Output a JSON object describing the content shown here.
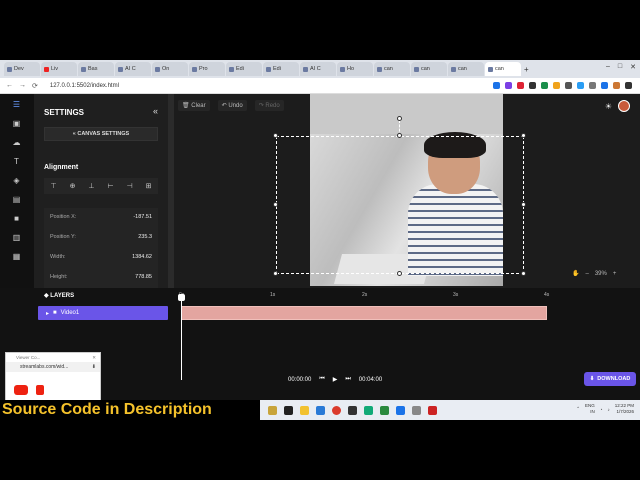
{
  "browser": {
    "tabs": [
      "Dev",
      "Liv",
      "Bas",
      "AI C",
      "On",
      "Pro",
      "Edi",
      "Edi",
      "AI C",
      "Ho",
      "can",
      "can",
      "can",
      "can"
    ],
    "active_tab_index": 13,
    "url": "127.0.0.1:5502/index.html",
    "controls": {
      "back": "←",
      "forward": "→",
      "reload": "⟳",
      "plus": "+"
    },
    "window_buttons": {
      "min": "–",
      "max": "□",
      "close": "✕"
    }
  },
  "toolbar": {
    "clear": "Clear",
    "undo": "Undo",
    "redo": "Redo"
  },
  "settings": {
    "title": "SETTINGS",
    "collapse": "«",
    "canvas_button": "« CANVAS SETTINGS",
    "alignment_title": "Alignment",
    "align_icons": [
      "⊤",
      "⊕",
      "⊥",
      "⊢",
      "⊣",
      "⊞"
    ],
    "properties": [
      {
        "label": "Position X:",
        "value": "-187.51"
      },
      {
        "label": "Position Y:",
        "value": "235.3"
      },
      {
        "label": "Width:",
        "value": "1384.62"
      },
      {
        "label": "Height:",
        "value": "778.85"
      }
    ]
  },
  "zoom": {
    "minus": "–",
    "value": "39%",
    "plus": "+"
  },
  "timeline": {
    "layers_label": "LAYERS",
    "ruler": [
      "0s",
      "1s",
      "2s",
      "3s",
      "4s"
    ],
    "layers": [
      {
        "name": "Video1"
      }
    ],
    "current_time": "00:00:00",
    "total_time": "00:04:00",
    "download_label": "DOWNLOAD"
  },
  "floating": {
    "title": "Viewer Co...",
    "url": "streamlabs.com/wid..."
  },
  "caption": "Source Code in  Description",
  "taskbar": {
    "lang": "ENG",
    "region": "IN",
    "time": "12:22 PM",
    "date": "1/7/2026"
  },
  "colors": {
    "accent": "#6a55e8",
    "clip": "#e3a5a0",
    "caption": "#f5c22b"
  }
}
